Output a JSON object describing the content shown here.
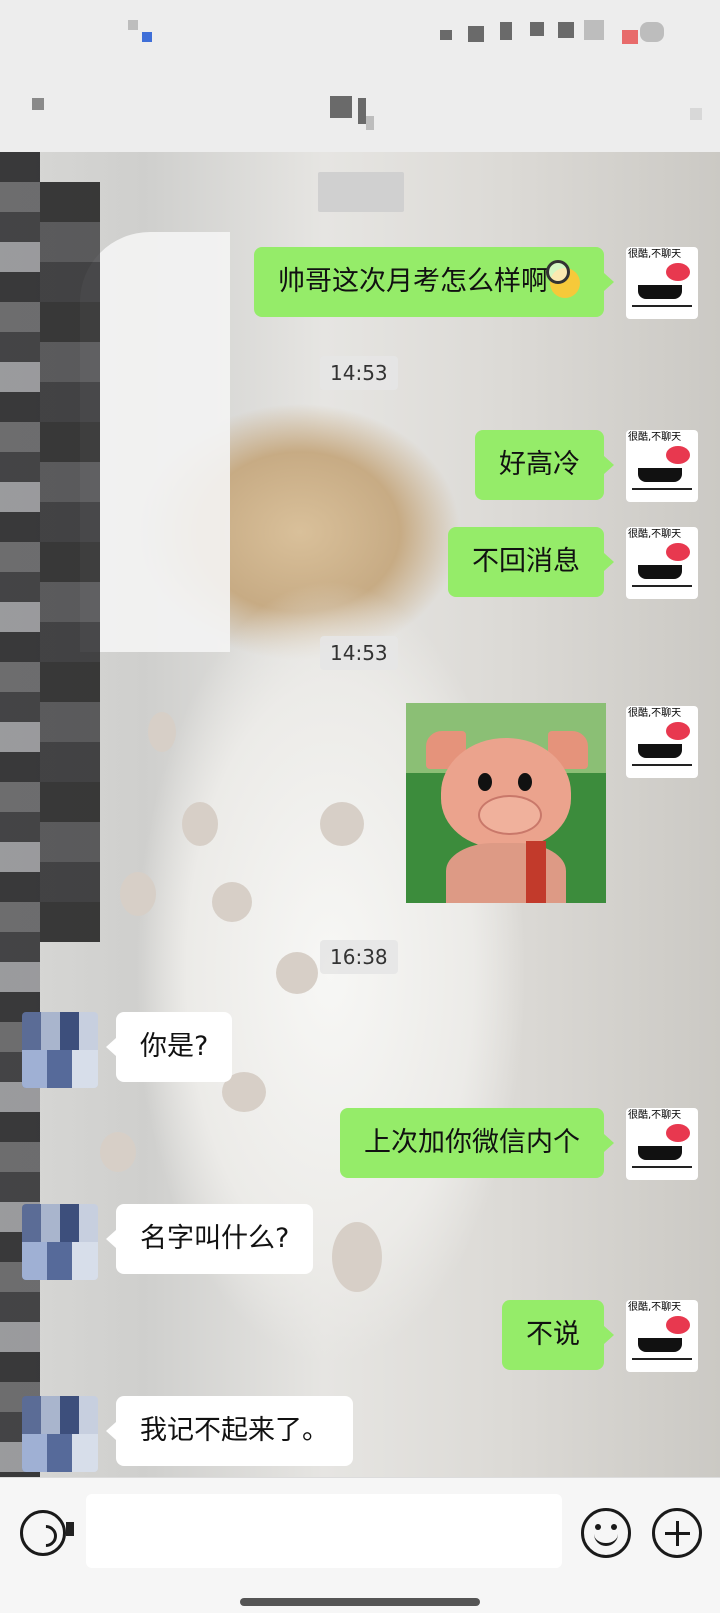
{
  "conversation": {
    "messages": [
      {
        "side": "out",
        "text": "帅哥这次月考怎么样啊"
      },
      {
        "side": "time",
        "text": "14:53"
      },
      {
        "side": "out",
        "text": "好高冷"
      },
      {
        "side": "out",
        "text": "不回消息"
      },
      {
        "side": "time",
        "text": "14:53"
      },
      {
        "side": "out",
        "type": "sticker",
        "description": "cartoon pig sticker"
      },
      {
        "side": "time",
        "text": "16:38"
      },
      {
        "side": "in",
        "text": "你是?"
      },
      {
        "side": "out",
        "text": "上次加你微信内个"
      },
      {
        "side": "in",
        "text": "名字叫什么?"
      },
      {
        "side": "out",
        "text": "不说"
      },
      {
        "side": "in",
        "text": "我记不起来了。"
      }
    ]
  },
  "my_avatar_caption": "很酷,不聊天",
  "colors": {
    "outgoing_bubble": "#95ec69",
    "incoming_bubble": "#ffffff",
    "background": "#ededed"
  },
  "icons": {
    "voice": "voice-icon",
    "emoji": "emoji-icon",
    "more": "plus-icon"
  }
}
